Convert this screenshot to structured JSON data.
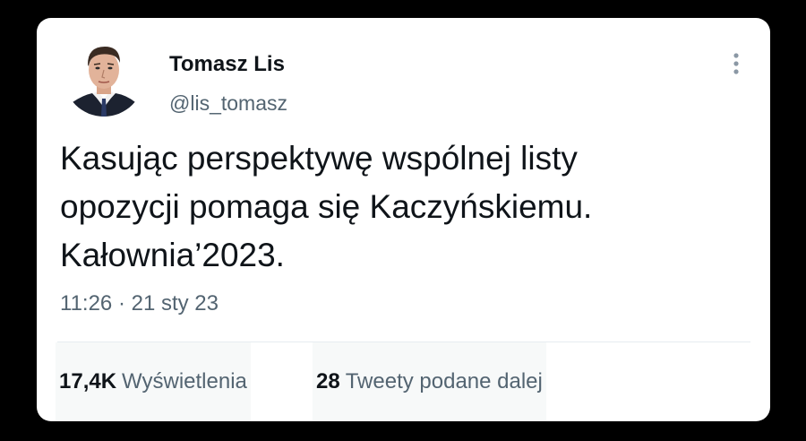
{
  "author": {
    "display_name": "Tomasz Lis",
    "handle": "@lis_tomasz"
  },
  "tweet": {
    "lines": [
      "Kasując perspektywę wspólnej listy",
      "opozycji pomaga się Kaczyńskiemu.",
      "Kałownia’2023."
    ],
    "timestamp": "11:26 · 21 sty 23"
  },
  "stats": {
    "views_count": "17,4K",
    "views_label": "Wyświetlenia",
    "retweets_count": "28",
    "retweets_label": "Tweety podane dalej"
  },
  "icons": {
    "more": "more-vertical-icon"
  },
  "colors": {
    "background": "#000000",
    "card": "#ffffff",
    "primary_text": "#0f1419",
    "secondary_text": "#536471",
    "divider": "#e6ecf0"
  }
}
